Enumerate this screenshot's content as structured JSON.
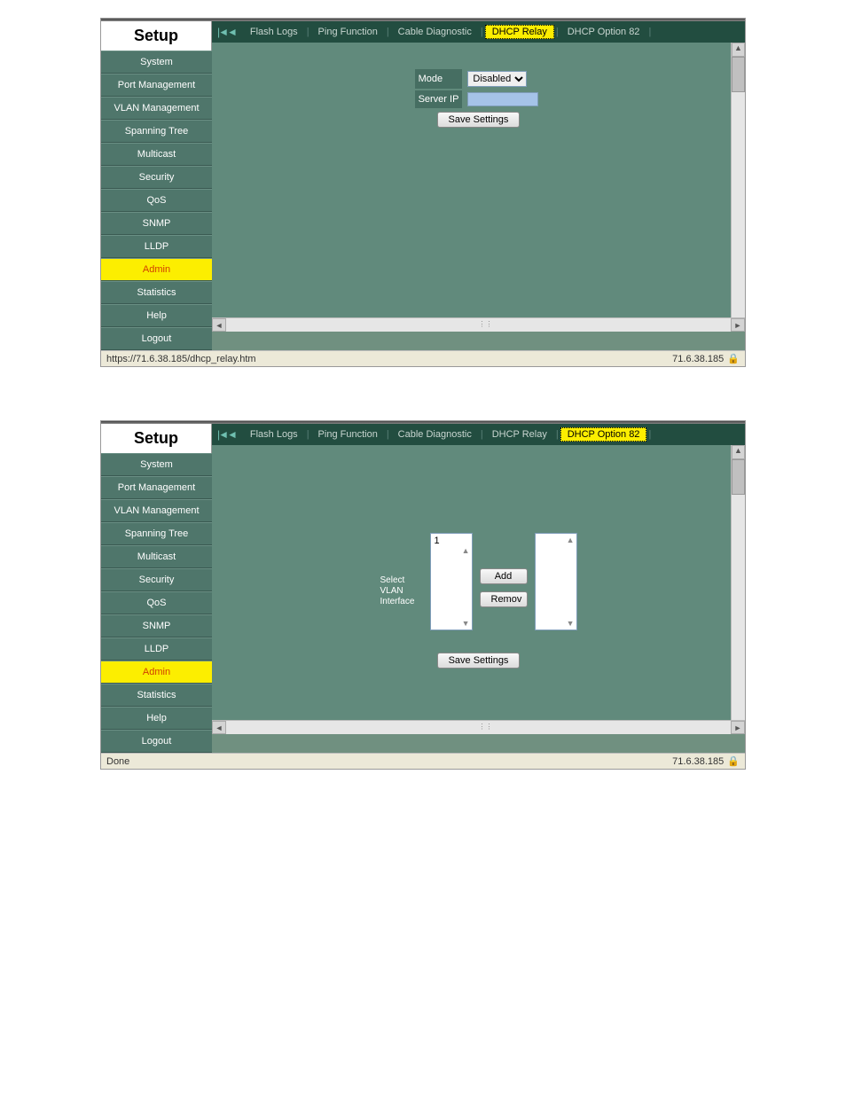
{
  "sidebar_title": "Setup",
  "sidebar": {
    "items": [
      "System",
      "Port Management",
      "VLAN Management",
      "Spanning Tree",
      "Multicast",
      "Security",
      "QoS",
      "SNMP",
      "LLDP",
      "Admin",
      "Statistics",
      "Help",
      "Logout"
    ],
    "active": "Admin"
  },
  "tabs": [
    "Flash Logs",
    "Ping Function",
    "Cable Diagnostic",
    "DHCP Relay",
    "DHCP Option 82"
  ],
  "screenshot1": {
    "active_tab": "DHCP Relay",
    "form": {
      "mode_label": "Mode",
      "mode_value": "Disabled",
      "server_ip_label": "Server IP",
      "server_ip_value": ""
    },
    "save_button": "Save Settings",
    "status_left": "https://71.6.38.185/dhcp_relay.htm",
    "status_right": "71.6.38.185"
  },
  "screenshot2": {
    "active_tab": "DHCP Option 82",
    "vlan_label": "Select VLAN Interface",
    "list_left_item": "1",
    "add_button": "Add",
    "remove_button": "Remov",
    "save_button": "Save Settings",
    "status_left": "Done",
    "status_right": "71.6.38.185"
  }
}
